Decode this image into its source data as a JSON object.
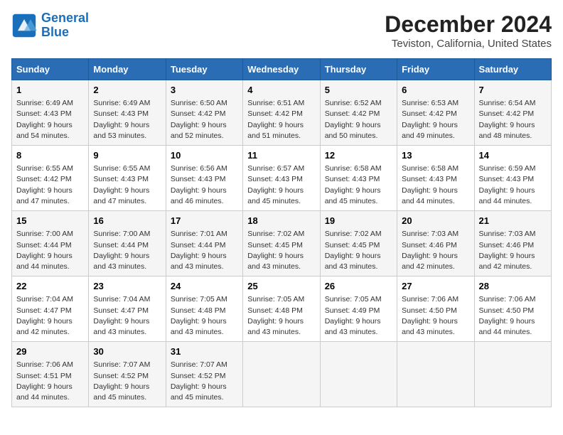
{
  "logo": {
    "text_general": "General",
    "text_blue": "Blue"
  },
  "title": "December 2024",
  "subtitle": "Teviston, California, United States",
  "headers": [
    "Sunday",
    "Monday",
    "Tuesday",
    "Wednesday",
    "Thursday",
    "Friday",
    "Saturday"
  ],
  "weeks": [
    [
      {
        "day": "1",
        "info": "Sunrise: 6:49 AM\nSunset: 4:43 PM\nDaylight: 9 hours\nand 54 minutes."
      },
      {
        "day": "2",
        "info": "Sunrise: 6:49 AM\nSunset: 4:43 PM\nDaylight: 9 hours\nand 53 minutes."
      },
      {
        "day": "3",
        "info": "Sunrise: 6:50 AM\nSunset: 4:42 PM\nDaylight: 9 hours\nand 52 minutes."
      },
      {
        "day": "4",
        "info": "Sunrise: 6:51 AM\nSunset: 4:42 PM\nDaylight: 9 hours\nand 51 minutes."
      },
      {
        "day": "5",
        "info": "Sunrise: 6:52 AM\nSunset: 4:42 PM\nDaylight: 9 hours\nand 50 minutes."
      },
      {
        "day": "6",
        "info": "Sunrise: 6:53 AM\nSunset: 4:42 PM\nDaylight: 9 hours\nand 49 minutes."
      },
      {
        "day": "7",
        "info": "Sunrise: 6:54 AM\nSunset: 4:42 PM\nDaylight: 9 hours\nand 48 minutes."
      }
    ],
    [
      {
        "day": "8",
        "info": "Sunrise: 6:55 AM\nSunset: 4:42 PM\nDaylight: 9 hours\nand 47 minutes."
      },
      {
        "day": "9",
        "info": "Sunrise: 6:55 AM\nSunset: 4:43 PM\nDaylight: 9 hours\nand 47 minutes."
      },
      {
        "day": "10",
        "info": "Sunrise: 6:56 AM\nSunset: 4:43 PM\nDaylight: 9 hours\nand 46 minutes."
      },
      {
        "day": "11",
        "info": "Sunrise: 6:57 AM\nSunset: 4:43 PM\nDaylight: 9 hours\nand 45 minutes."
      },
      {
        "day": "12",
        "info": "Sunrise: 6:58 AM\nSunset: 4:43 PM\nDaylight: 9 hours\nand 45 minutes."
      },
      {
        "day": "13",
        "info": "Sunrise: 6:58 AM\nSunset: 4:43 PM\nDaylight: 9 hours\nand 44 minutes."
      },
      {
        "day": "14",
        "info": "Sunrise: 6:59 AM\nSunset: 4:43 PM\nDaylight: 9 hours\nand 44 minutes."
      }
    ],
    [
      {
        "day": "15",
        "info": "Sunrise: 7:00 AM\nSunset: 4:44 PM\nDaylight: 9 hours\nand 44 minutes."
      },
      {
        "day": "16",
        "info": "Sunrise: 7:00 AM\nSunset: 4:44 PM\nDaylight: 9 hours\nand 43 minutes."
      },
      {
        "day": "17",
        "info": "Sunrise: 7:01 AM\nSunset: 4:44 PM\nDaylight: 9 hours\nand 43 minutes."
      },
      {
        "day": "18",
        "info": "Sunrise: 7:02 AM\nSunset: 4:45 PM\nDaylight: 9 hours\nand 43 minutes."
      },
      {
        "day": "19",
        "info": "Sunrise: 7:02 AM\nSunset: 4:45 PM\nDaylight: 9 hours\nand 43 minutes."
      },
      {
        "day": "20",
        "info": "Sunrise: 7:03 AM\nSunset: 4:46 PM\nDaylight: 9 hours\nand 42 minutes."
      },
      {
        "day": "21",
        "info": "Sunrise: 7:03 AM\nSunset: 4:46 PM\nDaylight: 9 hours\nand 42 minutes."
      }
    ],
    [
      {
        "day": "22",
        "info": "Sunrise: 7:04 AM\nSunset: 4:47 PM\nDaylight: 9 hours\nand 42 minutes."
      },
      {
        "day": "23",
        "info": "Sunrise: 7:04 AM\nSunset: 4:47 PM\nDaylight: 9 hours\nand 43 minutes."
      },
      {
        "day": "24",
        "info": "Sunrise: 7:05 AM\nSunset: 4:48 PM\nDaylight: 9 hours\nand 43 minutes."
      },
      {
        "day": "25",
        "info": "Sunrise: 7:05 AM\nSunset: 4:48 PM\nDaylight: 9 hours\nand 43 minutes."
      },
      {
        "day": "26",
        "info": "Sunrise: 7:05 AM\nSunset: 4:49 PM\nDaylight: 9 hours\nand 43 minutes."
      },
      {
        "day": "27",
        "info": "Sunrise: 7:06 AM\nSunset: 4:50 PM\nDaylight: 9 hours\nand 43 minutes."
      },
      {
        "day": "28",
        "info": "Sunrise: 7:06 AM\nSunset: 4:50 PM\nDaylight: 9 hours\nand 44 minutes."
      }
    ],
    [
      {
        "day": "29",
        "info": "Sunrise: 7:06 AM\nSunset: 4:51 PM\nDaylight: 9 hours\nand 44 minutes."
      },
      {
        "day": "30",
        "info": "Sunrise: 7:07 AM\nSunset: 4:52 PM\nDaylight: 9 hours\nand 45 minutes."
      },
      {
        "day": "31",
        "info": "Sunrise: 7:07 AM\nSunset: 4:52 PM\nDaylight: 9 hours\nand 45 minutes."
      },
      null,
      null,
      null,
      null
    ]
  ]
}
